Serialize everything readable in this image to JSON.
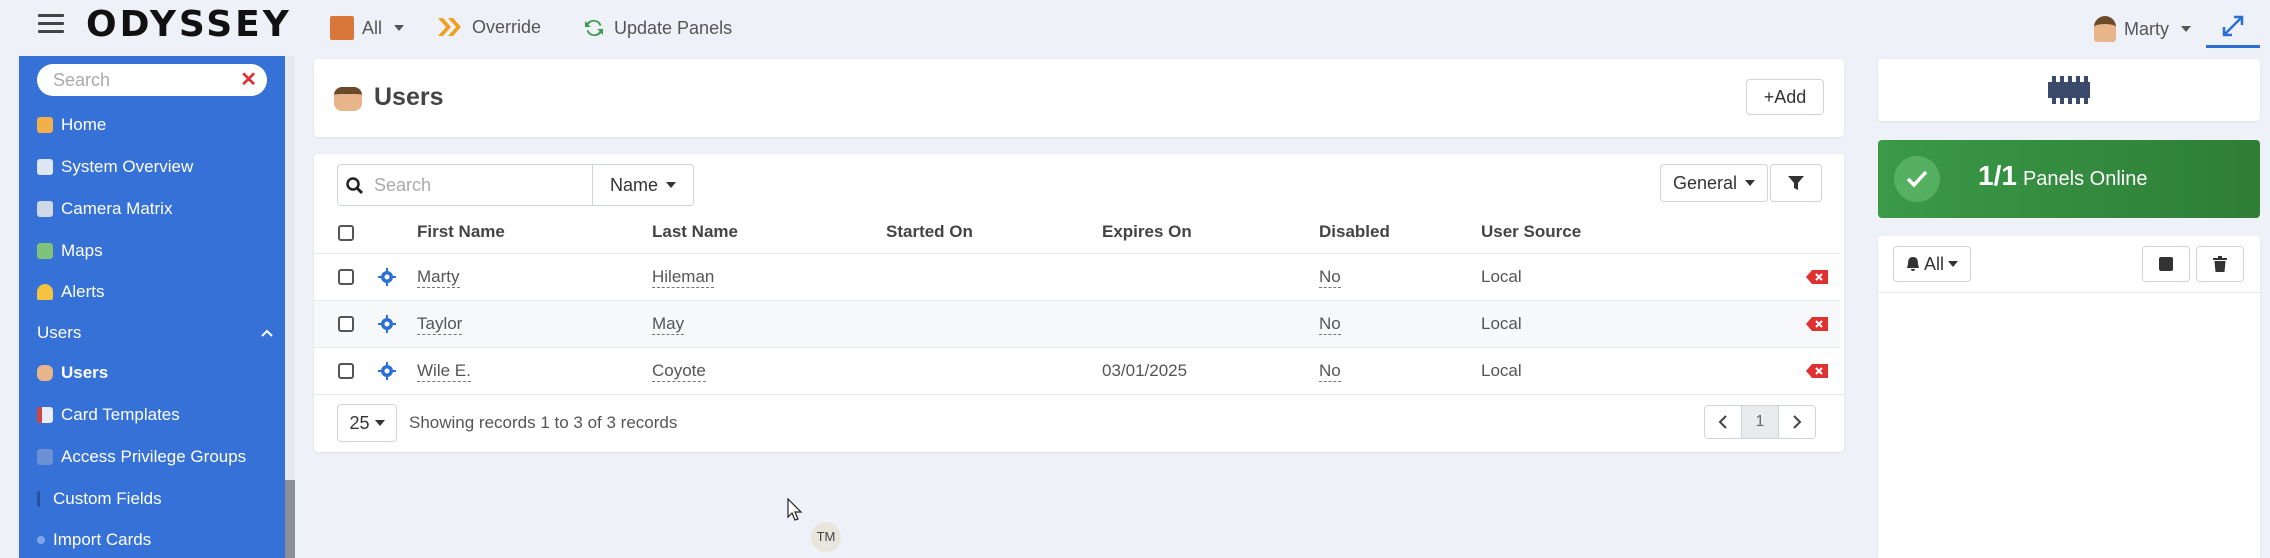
{
  "app": {
    "logo": "ODYSSEY"
  },
  "topbar": {
    "all_label": "All",
    "override_label": "Override",
    "update_panels_label": "Update Panels",
    "user_label": "Marty"
  },
  "sidebar": {
    "search_placeholder": "Search",
    "items": [
      {
        "label": "Home",
        "icon": "home-icon"
      },
      {
        "label": "System Overview",
        "icon": "system-overview-icon"
      },
      {
        "label": "Camera Matrix",
        "icon": "camera-icon"
      },
      {
        "label": "Maps",
        "icon": "map-icon"
      },
      {
        "label": "Alerts",
        "icon": "bell-icon"
      }
    ],
    "group_label": "Users",
    "sub_items": [
      {
        "label": "Users",
        "icon": "users-icon"
      },
      {
        "label": "Card Templates",
        "icon": "card-icon"
      },
      {
        "label": "Access Privilege Groups",
        "icon": "shield-icon"
      },
      {
        "label": "Custom Fields",
        "icon": "field-icon"
      },
      {
        "label": "Import Cards",
        "icon": "import-icon"
      }
    ]
  },
  "main": {
    "title": "Users",
    "add_label": "+Add",
    "search_placeholder": "Search",
    "name_filter_label": "Name",
    "general_label": "General",
    "columns": [
      "First Name",
      "Last Name",
      "Started On",
      "Expires On",
      "Disabled",
      "User Source"
    ],
    "rows": [
      {
        "first": "Marty",
        "last": "Hileman",
        "started": "",
        "expires": "",
        "disabled": "No",
        "source": "Local"
      },
      {
        "first": "Taylor",
        "last": "May",
        "started": "",
        "expires": "",
        "disabled": "No",
        "source": "Local"
      },
      {
        "first": "Wile E.",
        "last": "Coyote",
        "started": "",
        "expires": "03/01/2025",
        "disabled": "No",
        "source": "Local"
      }
    ],
    "page_size": "25",
    "records_text": "Showing records 1 to 3 of 3 records",
    "current_page": "1"
  },
  "right": {
    "panels_count": "1/1",
    "panels_text": "Panels Online",
    "bell_all_label": "All"
  },
  "tooltip": {
    "initials": "TM"
  },
  "colors": {
    "accent": "#3571d6",
    "success": "#2e8b3e",
    "danger": "#e03131"
  }
}
